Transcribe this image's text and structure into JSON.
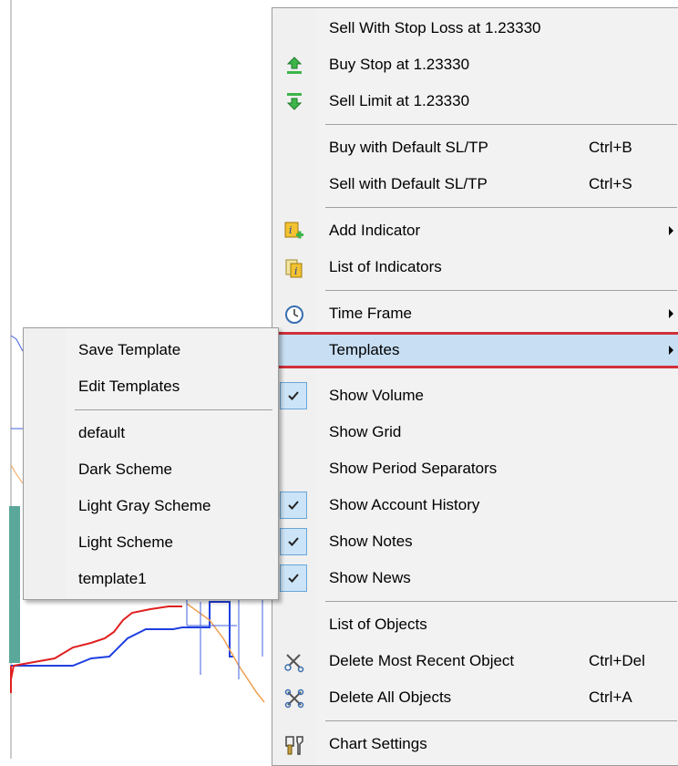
{
  "context_menu": {
    "items": [
      {
        "label": "Sell With Stop Loss at 1.23330",
        "icon": "none"
      },
      {
        "label": "Buy Stop at 1.23330",
        "icon": "buy-stop-arrow-up-icon"
      },
      {
        "label": "Sell Limit at 1.23330",
        "icon": "sell-limit-arrow-down-icon"
      },
      {
        "label": "Buy with Default SL/TP",
        "shortcut": "Ctrl+B"
      },
      {
        "label": "Sell with Default SL/TP",
        "shortcut": "Ctrl+S"
      },
      {
        "label": "Add Indicator",
        "icon": "add-indicator-icon",
        "submenu": true
      },
      {
        "label": "List of Indicators",
        "icon": "list-indicators-icon"
      },
      {
        "label": "Time Frame",
        "icon": "clock-icon",
        "submenu": true
      },
      {
        "label": "Templates",
        "submenu": true,
        "highlighted": true
      },
      {
        "label": "Show Volume",
        "checked": true
      },
      {
        "label": "Show Grid",
        "checked": false
      },
      {
        "label": "Show Period Separators",
        "checked": false
      },
      {
        "label": "Show Account History",
        "checked": true
      },
      {
        "label": "Show Notes",
        "checked": true
      },
      {
        "label": "Show News",
        "checked": true
      },
      {
        "label": "List of Objects"
      },
      {
        "label": "Delete Most Recent Object",
        "shortcut": "Ctrl+Del",
        "icon": "delete-recent-object-icon"
      },
      {
        "label": "Delete All Objects",
        "shortcut": "Ctrl+A",
        "icon": "delete-all-objects-icon"
      },
      {
        "label": "Chart Settings",
        "icon": "chart-settings-icon"
      }
    ]
  },
  "templates_submenu": {
    "items": [
      {
        "label": "Save Template"
      },
      {
        "label": "Edit Templates"
      },
      {
        "label": "default"
      },
      {
        "label": "Dark Scheme"
      },
      {
        "label": "Light Gray Scheme"
      },
      {
        "label": "Light Scheme"
      },
      {
        "label": "template1"
      }
    ]
  },
  "colors": {
    "highlight_bg": "#c7def3",
    "highlight_border": "#d0303a",
    "check_bg": "#cce4f7"
  }
}
